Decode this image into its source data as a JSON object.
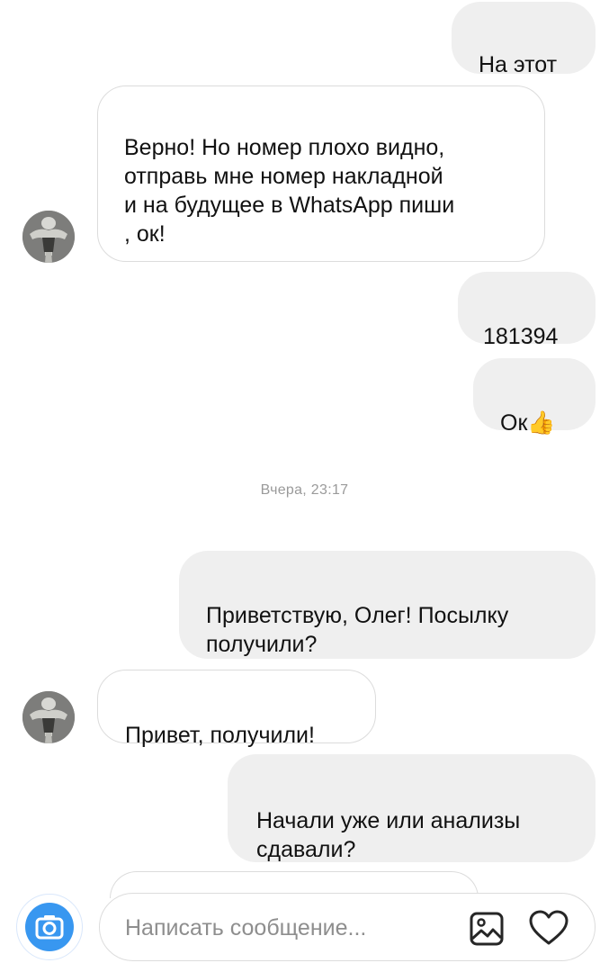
{
  "messages": {
    "m1": "На этот",
    "m2": "Верно! Но номер плохо видно,\nотправь мне номер накладной\nи на будущее в WhatsApp пиши\n, ок!",
    "m3": "181394",
    "m4": "Ок👍",
    "m5": "Приветствую, Олег! Посылку\nполучили?",
    "m6": "Привет, получили!",
    "m7": "Начали уже или анализы\nсдавали?"
  },
  "timestamp": "Вчера, 23:17",
  "composer": {
    "placeholder": "Написать сообщение..."
  },
  "icons": {
    "camera": "camera-icon",
    "gallery": "image-gallery-icon",
    "like": "heart-icon",
    "avatar": "user-avatar"
  },
  "colors": {
    "outgoing_bubble": "#efefef",
    "incoming_border": "#dcdcdc",
    "camera_accent": "#3897f0"
  }
}
